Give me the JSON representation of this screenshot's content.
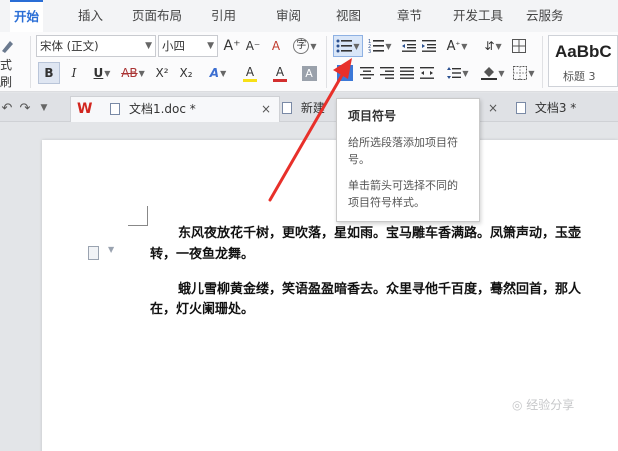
{
  "menu": {
    "items": [
      "开始",
      "插入",
      "页面布局",
      "引用",
      "审阅",
      "视图",
      "章节",
      "开发工具",
      "云服务"
    ],
    "active": "开始"
  },
  "ribbon": {
    "format_painter_label": "式刷",
    "font_name": "宋体 (正文)",
    "font_size": "小四",
    "bold": "B",
    "italic": "I",
    "underline": "U",
    "strikethrough": "AB",
    "superscript": "X²",
    "subscript": "X₂",
    "grow_font": "A⁺",
    "shrink_font": "A⁻",
    "clear_format": "A",
    "pinyin": "字",
    "text_effect": "A",
    "highlight": "A",
    "font_color": "A",
    "char_shading": "A",
    "style_sample": "AaBbC",
    "style_name": "标题 3",
    "colors": {
      "font_color_bar": "#d32f2f",
      "highlight_bar": "#f7e017",
      "accent": "#2a6ed6"
    }
  },
  "tabs": {
    "items": [
      {
        "label": "文档1.doc *"
      },
      {
        "label": "新建"
      },
      {
        "label": "文档3 *"
      }
    ],
    "close": "×"
  },
  "tooltip": {
    "title": "项目符号",
    "body1": "给所选段落添加项目符号。",
    "body2": "单击箭头可选择不同的项目符号样式。"
  },
  "document": {
    "lines": [
      "东风夜放花千树，更吹落，星如雨。宝马雕车香满路。凤箫声动，玉壶",
      "转，一夜鱼龙舞。",
      "蛾儿雪柳黄金缕，笑语盈盈暗香去。众里寻他千百度，蓦然回首，那人",
      "在，灯火阑珊处。"
    ]
  },
  "watermark": "◎ 经验分享"
}
